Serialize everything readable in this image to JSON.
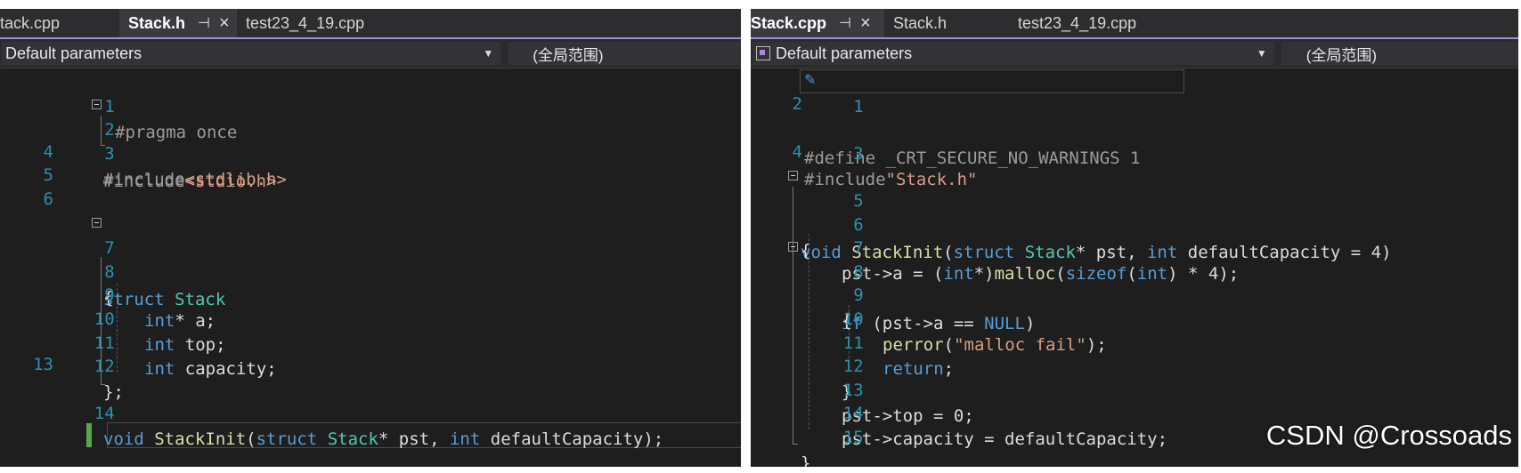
{
  "left": {
    "tabs": [
      {
        "label": "tack.cpp",
        "active": false
      },
      {
        "label": "Stack.h",
        "active": true,
        "pin_icon": "pin-icon",
        "close_icon": "close-icon"
      },
      {
        "label": "test23_4_19.cpp",
        "active": false
      }
    ],
    "nav": {
      "scope": "Default parameters",
      "range": "(全局范围)"
    },
    "line_numbers": [
      "1",
      "2",
      "3",
      "4",
      "5",
      "6",
      "7",
      "8",
      "9",
      "10",
      "11",
      "12",
      "13",
      "14"
    ],
    "code": {
      "l1": "#pragma once",
      "l2_kw": "#include",
      "l2_rest": "<stdio.h>",
      "l3_kw": "#include",
      "l3_rest": "<stdlib.h>",
      "l7_kw": "struct",
      "l7_name": "Stack",
      "l8": "{",
      "l9_kw": "int",
      "l9_rest": "* a;",
      "l10_kw": "int",
      "l10_rest": " top;",
      "l11_kw": "int",
      "l11_rest": " capacity;",
      "l12": "};",
      "l14_void": "void",
      "l14_fn": " StackInit",
      "l14_p1": "(",
      "l14_struct": "struct",
      "l14_sp": " ",
      "l14_stack": "Stack",
      "l14_p2": "* pst, ",
      "l14_int": "int",
      "l14_p3": " defaultCapacity);"
    }
  },
  "right": {
    "tabs": [
      {
        "label": "Stack.cpp",
        "active": true,
        "pin_icon": "pin-icon",
        "close_icon": "close-icon"
      },
      {
        "label": "Stack.h",
        "active": false
      },
      {
        "label": "test23_4_19.cpp",
        "active": false
      }
    ],
    "nav": {
      "scope": "Default parameters",
      "range": "(全局范围)"
    },
    "line_numbers": [
      "1",
      "2",
      "3",
      "4",
      "5",
      "6",
      "7",
      "8",
      "9",
      "10",
      "11",
      "12",
      "13",
      "14",
      "15"
    ],
    "code": {
      "l1": "#define _CRT_SECURE_NO_WARNINGS 1",
      "l3_kw": "#include",
      "l3_str": "\"Stack.h\"",
      "l5_void": "void",
      "l5_fn": " StackInit",
      "l5_p1": "(",
      "l5_struct": "struct",
      "l5_sp": " ",
      "l5_stack": "Stack",
      "l5_p2": "* pst, ",
      "l5_int": "int",
      "l5_p3": " defaultCapacity = 4)",
      "l6": "{",
      "l7_a": "pst->a = (",
      "l7_int": "int",
      "l7_b": "*)",
      "l7_malloc": "malloc",
      "l7_c": "(",
      "l7_sizeof": "sizeof",
      "l7_d": "(",
      "l7_int2": "int",
      "l7_e": ") * 4);",
      "l8_if": "if",
      "l8_a": " (pst->a == ",
      "l8_null": "NULL",
      "l8_b": ")",
      "l9": "{",
      "l10_perror": "perror",
      "l10_a": "(",
      "l10_str": "\"malloc fail\"",
      "l10_b": ");",
      "l11_ret": "return",
      "l11_a": ";",
      "l12": "}",
      "l13": "pst->top = 0;",
      "l14": "pst->capacity = defaultCapacity;",
      "l15": "}"
    }
  },
  "watermark": "CSDN @Crossoads"
}
